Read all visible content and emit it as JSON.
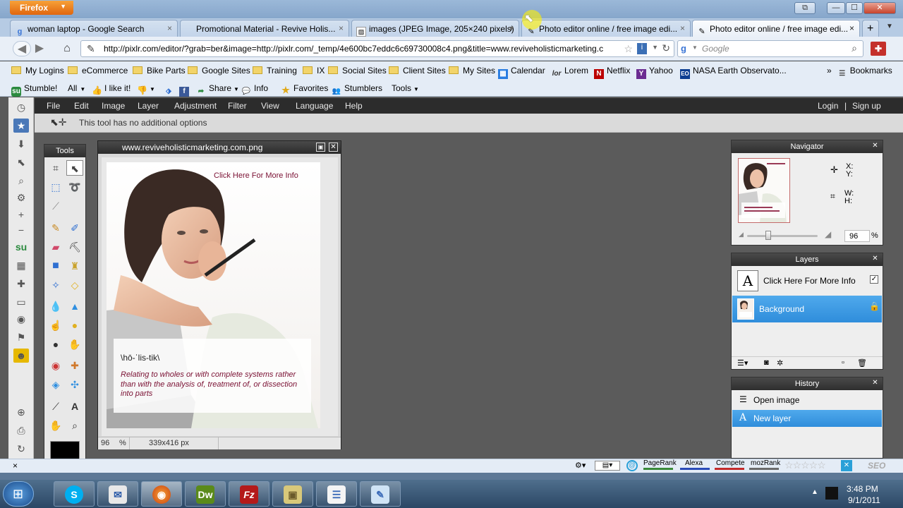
{
  "browser": {
    "menu_label": "Firefox",
    "window_controls": {
      "restore": "⧉",
      "minimize": "—",
      "maximize": "☐",
      "close": "✕"
    },
    "tabs": [
      {
        "label": "woman laptop - Google Search",
        "icon": "google-icon"
      },
      {
        "label": "Promotional Material - Revive Holis...",
        "icon": "none"
      },
      {
        "label": "images (JPEG Image, 205×240 pixels)",
        "icon": "image-icon"
      },
      {
        "label": "Photo editor online / free image edi...",
        "icon": "pixlr-icon"
      },
      {
        "label": "Photo editor online / free image edi...",
        "icon": "pixlr-icon"
      }
    ],
    "new_tab": "+",
    "url": "http://pixlr.com/editor/?grab=ber&image=http://pixlr.com/_temp/4e600bc7eddc6c69730008c4.png&title=www.reviveholisticmarketing.c",
    "search_placeholder": "Google",
    "bookmarks": [
      "My Logins",
      "eCommerce",
      "Bike Parts",
      "Google Sites",
      "Training",
      "IX",
      "Social Sites",
      "Client Sites",
      "My Sites",
      "Calendar",
      "Lorem",
      "Netflix",
      "Yahoo",
      "NASA Earth Observato...",
      "Bookmarks"
    ],
    "stumble": {
      "stumble": "Stumble!",
      "all": "All",
      "like": "I like it!",
      "share": "Share",
      "info": "Info",
      "favorites": "Favorites",
      "stumblers": "Stumblers",
      "tools": "Tools"
    }
  },
  "pixlr": {
    "menu": [
      "File",
      "Edit",
      "Image",
      "Layer",
      "Adjustment",
      "Filter",
      "View",
      "Language",
      "Help"
    ],
    "login": "Login",
    "separator": "|",
    "signup": "Sign up",
    "tool_options": "This tool has no additional options",
    "tools_title": "Tools",
    "document": {
      "title": "www.reviveholisticmarketing.com.png",
      "zoom": "96",
      "zoom_unit": "%",
      "size": "339x416 px",
      "cta": "Click Here For More Info",
      "phonetic": "\\hō-ˈlis-tik\\",
      "definition": "Relating to wholes or with complete systems rather than with the analysis of, treatment of, or dissection into parts"
    },
    "navigator": {
      "title": "Navigator",
      "x": "X:",
      "y": "Y:",
      "w": "W:",
      "h": "H:",
      "zoom": "96",
      "zoom_unit": "%"
    },
    "layers": {
      "title": "Layers",
      "items": [
        {
          "name": "Click Here For More Info",
          "type": "text"
        },
        {
          "name": "Background",
          "type": "image"
        }
      ]
    },
    "history": {
      "title": "History",
      "items": [
        "Open image",
        "New layer"
      ]
    }
  },
  "statusbar": {
    "pagerank": "PageRank",
    "alexa": "Alexa",
    "compete": "Compete",
    "mozrank": "mozRank",
    "seo": "SEO"
  },
  "taskbar": {
    "time": "3:48 PM",
    "date": "9/1/2011",
    "apps": [
      "Skype",
      "Outlook",
      "Firefox",
      "Dreamweaver",
      "FileZilla",
      "Explorer",
      "Document",
      "Notepad"
    ]
  },
  "colors": {
    "accent": "#2f8ddb",
    "menu_bg": "#2c2c2c",
    "workspace": "#5b5b5b",
    "cta_text": "#7a1033"
  }
}
